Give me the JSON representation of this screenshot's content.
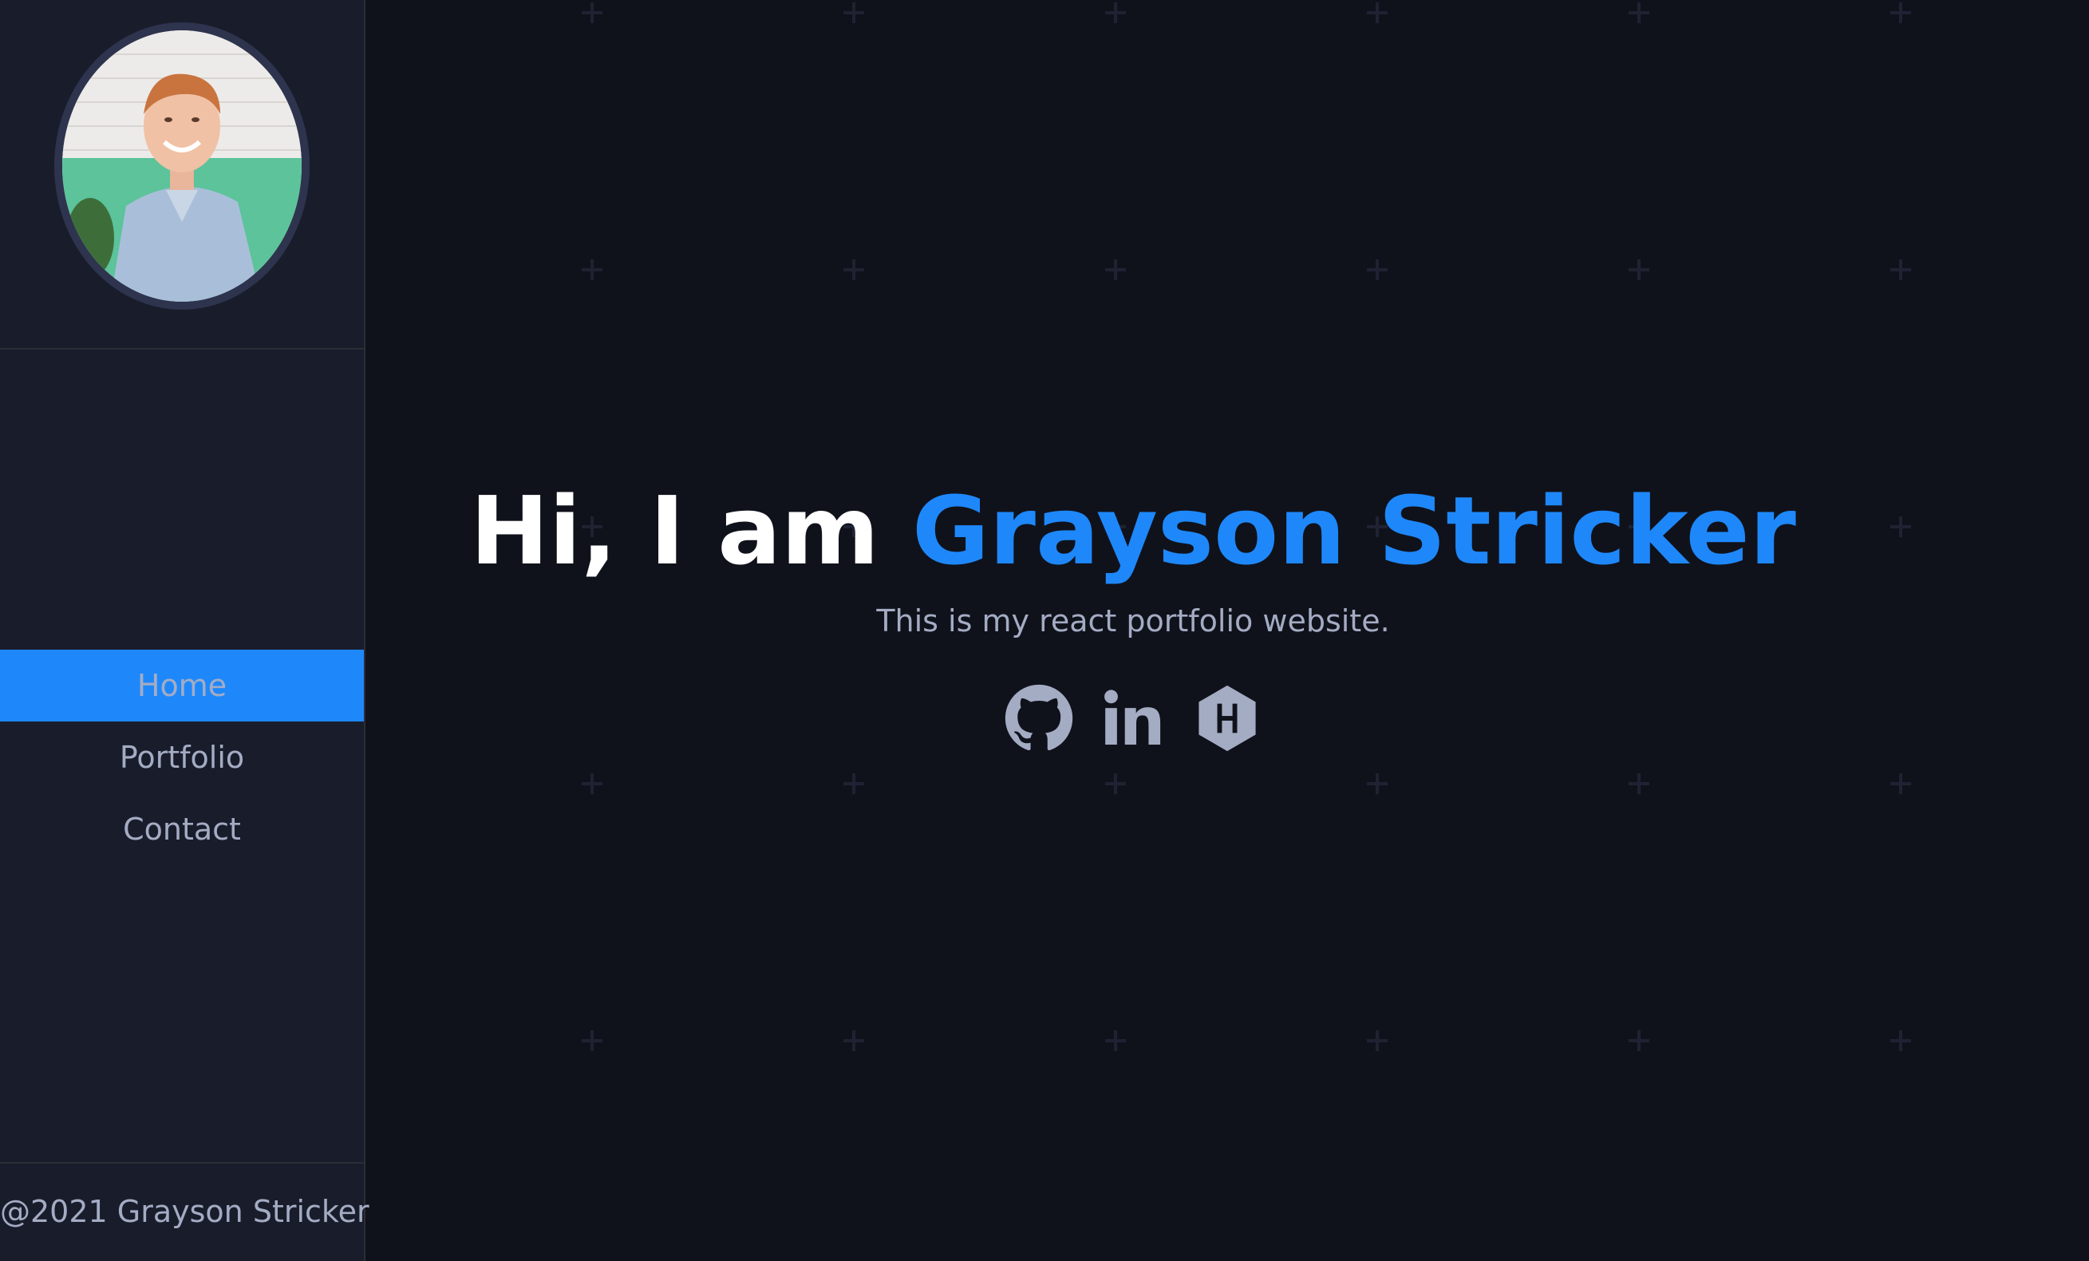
{
  "sidebar": {
    "nav_items": [
      {
        "label": "Home",
        "active": true
      },
      {
        "label": "Portfolio",
        "active": false
      },
      {
        "label": "Contact",
        "active": false
      }
    ],
    "footer_text": "@2021 Grayson Stricker"
  },
  "hero": {
    "greeting": "Hi, I am",
    "name": "Grayson Stricker",
    "subtitle": "This is my react portfolio website."
  },
  "socials": [
    {
      "icon": "github-icon"
    },
    {
      "icon": "linkedin-icon"
    },
    {
      "icon": "hackerrank-icon"
    }
  ],
  "colors": {
    "accent": "#1e88fb",
    "sidebar_bg": "#191d2b",
    "main_bg": "#10121b",
    "text_muted": "#a4acc4"
  }
}
